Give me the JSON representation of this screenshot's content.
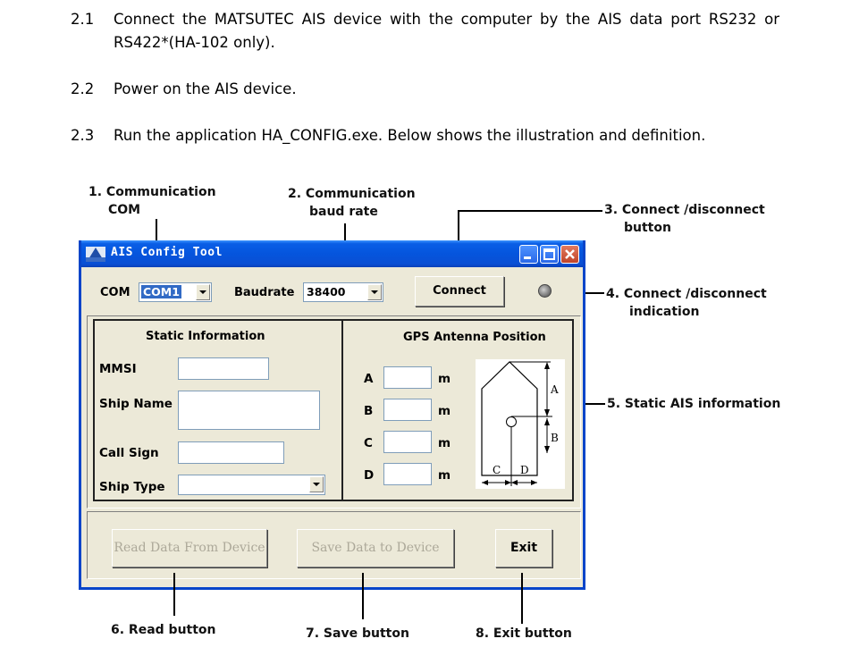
{
  "steps": [
    {
      "number": "2.1",
      "text": "Connect the MATSUTEC AIS device with the computer by the AIS data port RS232 or RS422*(HA-102 only)."
    },
    {
      "number": "2.2",
      "text": "Power on the AIS device."
    },
    {
      "number": "2.3",
      "text": "Run the application HA_CONFIG.exe. Below shows the illustration and definition."
    }
  ],
  "callouts": {
    "c1": {
      "line1": "1. Communication",
      "line2": "COM"
    },
    "c2": {
      "line1": "2. Communication",
      "line2": "baud rate"
    },
    "c3": {
      "line1": "3. Connect /disconnect",
      "line2": "button"
    },
    "c4": {
      "line1": "4. Connect /disconnect",
      "line2": "indication"
    },
    "c5": {
      "line1": "5. Static AIS information"
    },
    "c6": {
      "line1": "6. Read button"
    },
    "c7": {
      "line1": "7. Save button"
    },
    "c8": {
      "line1": "8. Exit button"
    }
  },
  "window": {
    "title": "AIS Config Tool",
    "com_label": "COM",
    "com_value": "COM1",
    "baud_label": "Baudrate",
    "baud_value": "38400",
    "connect_label": "Connect",
    "static_title": "Static Information",
    "mmsi_label": "MMSI",
    "ship_name_label": "Ship Name",
    "call_sign_label": "Call Sign",
    "ship_type_label": "Ship Type",
    "gps_title": "GPS Antenna Position",
    "gps_rows": [
      {
        "label": "A",
        "unit": "m"
      },
      {
        "label": "B",
        "unit": "m"
      },
      {
        "label": "C",
        "unit": "m"
      },
      {
        "label": "D",
        "unit": "m"
      }
    ],
    "diagram_labels": {
      "a": "A",
      "b": "B",
      "c": "C",
      "d": "D"
    },
    "read_label": "Read Data From Device",
    "save_label": "Save Data to Device",
    "exit_label": "Exit"
  }
}
